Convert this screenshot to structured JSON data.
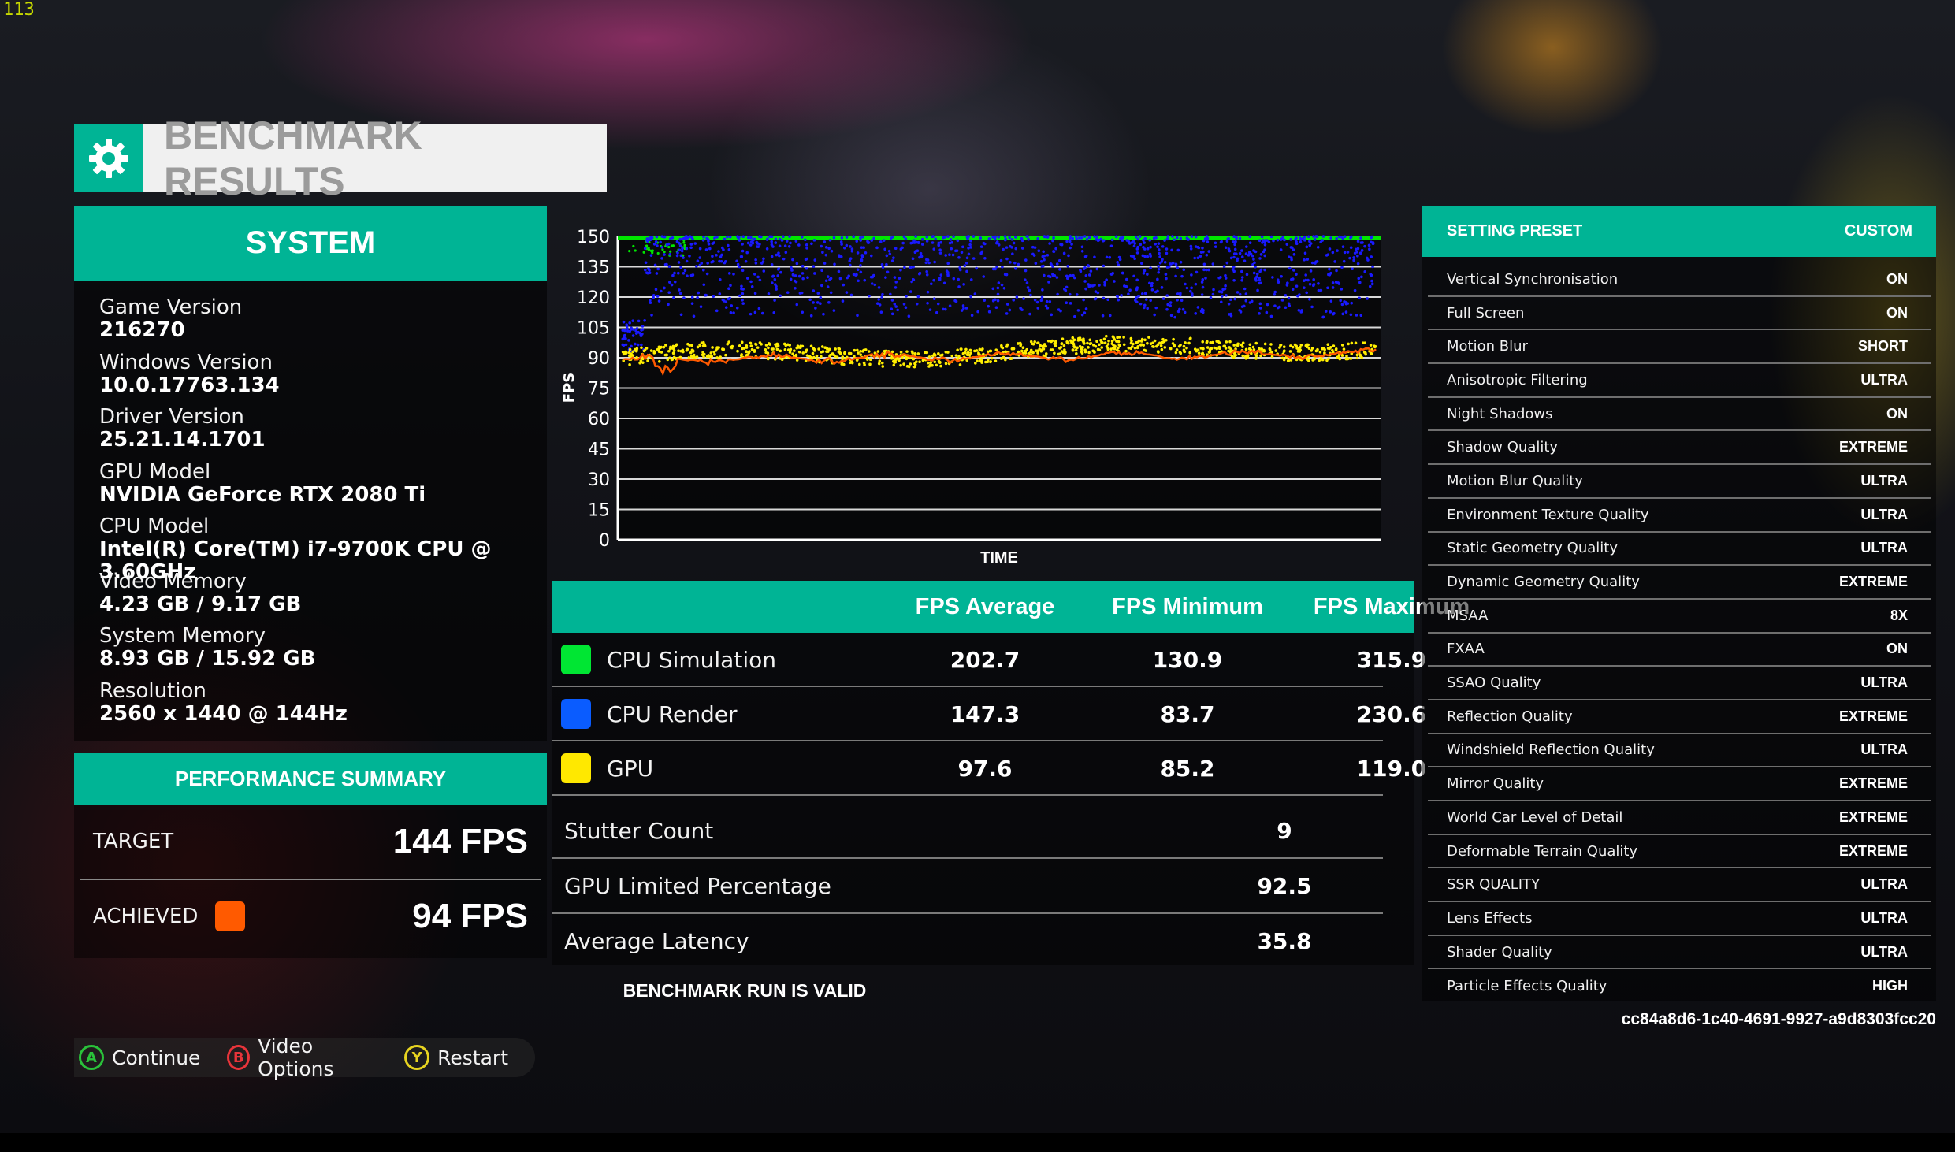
{
  "overlay": {
    "fps_counter": "113"
  },
  "header": {
    "title": "BENCHMARK RESULTS",
    "icon": "gear-icon"
  },
  "system": {
    "heading": "SYSTEM",
    "items": [
      {
        "label": "Game Version",
        "value": "216270"
      },
      {
        "label": "Windows Version",
        "value": "10.0.17763.134"
      },
      {
        "label": "Driver Version",
        "value": "25.21.14.1701"
      },
      {
        "label": "GPU Model",
        "value": "NVIDIA GeForce RTX 2080 Ti"
      },
      {
        "label": "CPU Model",
        "value": "Intel(R) Core(TM) i7-9700K CPU @ 3.60GHz"
      },
      {
        "label": "Video Memory",
        "value": "4.23 GB / 9.17 GB"
      },
      {
        "label": "System Memory",
        "value": "8.93 GB / 15.92 GB"
      },
      {
        "label": "Resolution",
        "value": "2560 x 1440 @ 144Hz"
      }
    ]
  },
  "performance": {
    "heading": "PERFORMANCE SUMMARY",
    "target_label": "TARGET",
    "target_value": "144 FPS",
    "achieved_label": "ACHIEVED",
    "achieved_value": "94 FPS",
    "achieved_color": "#ff5a00"
  },
  "chart_data": {
    "type": "line",
    "ylabel": "FPS",
    "xlabel": "TIME",
    "ylim": [
      0,
      150
    ],
    "y_ticks": [
      0,
      15,
      30,
      45,
      60,
      75,
      90,
      105,
      120,
      135,
      150
    ],
    "grid": true,
    "series": [
      {
        "name": "CPU Simulation",
        "color": "#00e600",
        "mean": 150,
        "band": [
          140,
          150
        ],
        "style": "dense-line"
      },
      {
        "name": "CPU Render",
        "color": "#1a1aff",
        "mean": 138,
        "band": [
          110,
          150
        ],
        "style": "scatter"
      },
      {
        "name": "GPU",
        "color": "#ffee00",
        "mean": 95,
        "band": [
          88,
          103
        ],
        "style": "scatter"
      },
      {
        "name": "ACHIEVED",
        "color": "#ff5a00",
        "mean": 91,
        "band": [
          80,
          95
        ],
        "style": "line"
      }
    ]
  },
  "results": {
    "headers": [
      "FPS Average",
      "FPS Minimum",
      "FPS Maximum"
    ],
    "rows": [
      {
        "name": "CPU Simulation",
        "color": "#00e633",
        "avg": "202.7",
        "min": "130.9",
        "max": "315.9"
      },
      {
        "name": "CPU Render",
        "color": "#0a5cff",
        "avg": "147.3",
        "min": "83.7",
        "max": "230.6"
      },
      {
        "name": "GPU",
        "color": "#ffe800",
        "avg": "97.6",
        "min": "85.2",
        "max": "119.0"
      }
    ],
    "stats": [
      {
        "name": "Stutter Count",
        "value": "9"
      },
      {
        "name": "GPU Limited Percentage",
        "value": "92.5"
      },
      {
        "name": "Average Latency",
        "value": "35.8"
      }
    ],
    "valid_text": "BENCHMARK RUN IS VALID"
  },
  "buttons": [
    {
      "key": "A",
      "label": "Continue",
      "color": "#2ac23a"
    },
    {
      "key": "B",
      "label": "Video Options",
      "color": "#e8343a"
    },
    {
      "key": "Y",
      "label": "Restart",
      "color": "#e6d320"
    }
  ],
  "settings": {
    "preset_label": "SETTING PRESET",
    "preset_value": "CUSTOM",
    "items": [
      {
        "k": "Vertical Synchronisation",
        "v": "ON"
      },
      {
        "k": "Full Screen",
        "v": "ON"
      },
      {
        "k": "Motion Blur",
        "v": "SHORT"
      },
      {
        "k": "Anisotropic Filtering",
        "v": "ULTRA"
      },
      {
        "k": "Night Shadows",
        "v": "ON"
      },
      {
        "k": "Shadow Quality",
        "v": "EXTREME"
      },
      {
        "k": "Motion Blur Quality",
        "v": "ULTRA"
      },
      {
        "k": "Environment Texture Quality",
        "v": "ULTRA"
      },
      {
        "k": "Static Geometry Quality",
        "v": "ULTRA"
      },
      {
        "k": "Dynamic Geometry Quality",
        "v": "EXTREME"
      },
      {
        "k": "MSAA",
        "v": "8X"
      },
      {
        "k": "FXAA",
        "v": "ON"
      },
      {
        "k": "SSAO Quality",
        "v": "ULTRA"
      },
      {
        "k": "Reflection Quality",
        "v": "EXTREME"
      },
      {
        "k": "Windshield Reflection Quality",
        "v": "ULTRA"
      },
      {
        "k": "Mirror Quality",
        "v": "EXTREME"
      },
      {
        "k": "World Car Level of Detail",
        "v": "EXTREME"
      },
      {
        "k": "Deformable Terrain Quality",
        "v": "EXTREME"
      },
      {
        "k": "SSR QUALITY",
        "v": "ULTRA"
      },
      {
        "k": "Lens Effects",
        "v": "ULTRA"
      },
      {
        "k": "Shader Quality",
        "v": "ULTRA"
      },
      {
        "k": "Particle Effects Quality",
        "v": "HIGH"
      }
    ]
  },
  "run_id": "cc84a8d6-1c40-4691-9927-a9d8303fcc20"
}
